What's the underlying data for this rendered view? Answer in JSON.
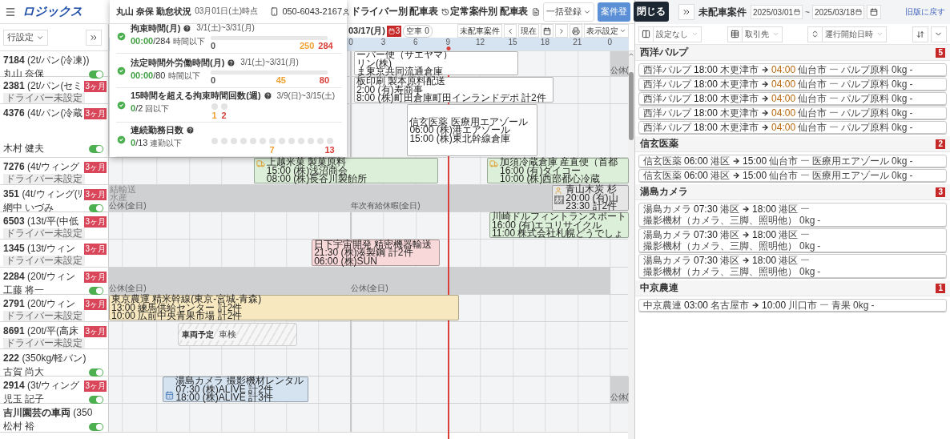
{
  "header": {
    "logo": "ロジックス",
    "nav_tabs": [
      {
        "label": "ドライバー別 配車表",
        "kind": "driver"
      },
      {
        "label": "定常案件別 配車表",
        "kind": "regular"
      }
    ],
    "bulk_button": "一括登録",
    "create_button": "案件登",
    "tooltip": "閉じる"
  },
  "toolbar": {
    "row_settings": "行設定",
    "date": "03/17(月)",
    "alert_count": "3",
    "vacant": "空車 0",
    "unassigned_button": "未配車案件",
    "now_button": "現在",
    "display_settings": "表示設定"
  },
  "axis": [
    "0",
    "3",
    "6",
    "9",
    "12",
    "15",
    "18",
    "21",
    "0"
  ],
  "vehicles": [
    {
      "number": "7184",
      "type": "(2t/パン(冷凍))",
      "driver": "丸山 奈保",
      "driver_set": true,
      "available": true,
      "events": [
        {
          "kind": "plain",
          "color": "#ffffff",
          "lines": [
            "ーパー便（サエヤマ）",
            "リン(株)",
            "ま東京共同流通倉庫"
          ]
        },
        {
          "kind": "holiday",
          "label": "公休("
        }
      ]
    },
    {
      "number": "2381",
      "type": "(2t/パン(セミ",
      "badge": "3ヶ月",
      "driver": "ドライバー未設定",
      "driver_set": false,
      "events": [
        {
          "kind": "plain",
          "color": "#ffffff",
          "lines": [
            "板印刷 製本原料配送",
            "2:00 (有)寿商事",
            "8:00 (株)町田倉庫町田インランドデポ 計2件"
          ]
        }
      ]
    },
    {
      "number": "4376",
      "type": "(4t/パン(冷蔵",
      "badge": "3ヶ月",
      "driver": "木村 健夫",
      "driver_set": true,
      "available": true,
      "events": [
        {
          "kind": "plain",
          "color": "#ffffff",
          "lines": [
            "信玄医薬 医療用エアゾール",
            "06:00 (株)港エアゾール",
            "15:00 (株)東北幹線倉庫"
          ]
        }
      ]
    },
    {
      "number": "7276",
      "type": "(4t/ウィング",
      "badge": "3ヶ月",
      "driver": "ドライバー未設定",
      "driver_set": false,
      "events": [
        {
          "kind": "truck",
          "color": "#dcefd8",
          "lines": [
            "上越米菓 製菓原料",
            "15:00 (株)浅沼商会",
            "08:00 (株)長谷川製飴所"
          ]
        },
        {
          "kind": "truck",
          "color": "#dcefd8",
          "lines": [
            "加須冷蔵倉庫 産直便（首都",
            "16:00 (有)ダイコー",
            "10:00 (株)西部都心冷蔵"
          ]
        }
      ]
    },
    {
      "number": "351",
      "type": "(4t/ウィング(ﾘ",
      "badge": "3ヶ月",
      "driver": "網中 いづみ",
      "driver_set": true,
      "available": true,
      "events": [
        {
          "kind": "ghost",
          "lines": [
            "結輸送",
            "水産"
          ]
        },
        {
          "kind": "holiday",
          "label": "公休(全日)"
        },
        {
          "kind": "holiday",
          "label": "年次有給休暇(全日)"
        },
        {
          "kind": "staff",
          "color": "#e6e6e6",
          "tag": "材",
          "lines": [
            "青山木炭 杉",
            "20:00 (有)山",
            "23:30 計2件"
          ]
        }
      ]
    },
    {
      "number": "6503",
      "type": "(13t/平(中低",
      "badge": "3ヶ月",
      "driver": "ドライバー未設定",
      "driver_set": false,
      "events": [
        {
          "kind": "plain",
          "color": "#dcefd8",
          "lines": [
            "川崎ドルフィントランスポート",
            "16:00 (有)エコリサイクル",
            "11:00 株式会社札幌どうでしょ"
          ]
        }
      ]
    },
    {
      "number": "1345",
      "type": "(13t/ウィン",
      "badge": "3ヶ月",
      "driver": "ドライバー未設定",
      "driver_set": false,
      "events": [
        {
          "kind": "plain",
          "color": "#f8d8d8",
          "lines": [
            "日下宇宙開発 精密機器輸送",
            "21:30 (株)湊製鋼 計2件",
            "06:00 (株)SUN"
          ]
        }
      ]
    },
    {
      "number": "2284",
      "type": "(20t/ウィン",
      "badge": "3ヶ月",
      "driver": "工藤 将一",
      "driver_set": true,
      "available": true,
      "events": [
        {
          "kind": "holiday",
          "label": "公休(全日)"
        },
        {
          "kind": "holiday",
          "label": "公休(全日)"
        }
      ]
    },
    {
      "number": "2791",
      "type": "(20t/ウィン",
      "badge": "3ヶ月",
      "driver": "ドライバー未設定",
      "driver_set": false,
      "events": [
        {
          "kind": "plain",
          "color": "#f7e8c0",
          "lines": [
            "東京農運 精米幹線(東京-宮城-青森)",
            "13:00 練馬供給センター 計2件",
            "10:00 広前中央青果市場 計2件"
          ]
        }
      ]
    },
    {
      "number": "8691",
      "type": "(20t/平(高床",
      "badge": "3ヶ月",
      "driver": "ドライバー未設定",
      "driver_set": false,
      "events": [
        {
          "kind": "maintenance",
          "tag": "車両予定",
          "lines": [
            "車検"
          ]
        }
      ]
    },
    {
      "number": "222",
      "type": "(350kg/軽バン)",
      "driver": "古賀 尚大",
      "driver_set": true,
      "available": true
    },
    {
      "number": "2914",
      "type": "(3t/ウィング",
      "badge": "3ヶ月",
      "driver": "児玉 記子",
      "driver_set": true,
      "available": true,
      "events": [
        {
          "kind": "calendar",
          "color": "#d5e3f1",
          "lines": [
            "湯島カメラ 撮影機材レンタル",
            "07:30 (株)ALIVE 計2件",
            "18:00 (株)ALIVE 計3件"
          ]
        },
        {
          "kind": "holiday",
          "label": "公休("
        }
      ]
    },
    {
      "number": "吉川園芸の車両",
      "type": "(350",
      "driver": "松村 裕",
      "driver_set": true,
      "available": true
    }
  ],
  "attendance": {
    "title": "丸山 奈保 勤怠状況",
    "as_of": "03月01日(土)時点",
    "phone": "050-6043-2167",
    "metrics": [
      {
        "kind": "bar",
        "ok": true,
        "title": "拘束時間(月)",
        "period": "3/1(土)~3/31(月)",
        "value": "00:00",
        "limit": "/284",
        "unit": "時間以下",
        "level": 0,
        "ticks": [
          {
            "label": "0",
            "color": "#555555"
          },
          {
            "label": "250",
            "color": "#f0a030"
          },
          {
            "label": "284",
            "color": "#d9403a"
          }
        ]
      },
      {
        "kind": "bar",
        "ok": true,
        "title": "法定時間外労働時間(月)",
        "period": "3/1(土)~3/31(月)",
        "value": "00:00",
        "limit": "/80",
        "unit": "時間以下",
        "level": 0,
        "ticks": [
          {
            "label": "0",
            "color": "#555555"
          },
          {
            "label": "45",
            "color": "#f0a030"
          },
          {
            "label": "80",
            "color": "#d9403a"
          }
        ]
      },
      {
        "kind": "dots",
        "ok": true,
        "title": "15時間を超える拘束時間回数(週)",
        "period": "3/9(日)~3/15(土)",
        "value": "0",
        "limit": "/2",
        "unit": "回以下",
        "dots": [
          {
            "filled": false,
            "label": "1",
            "color": "#f0a030"
          },
          {
            "filled": false,
            "label": "2",
            "color": "#d9403a"
          }
        ]
      },
      {
        "kind": "dots",
        "ok": true,
        "title": "連続勤務日数",
        "value": "0",
        "limit": "/13",
        "unit": "連勤以下",
        "dots": [
          {
            "filled": false
          },
          {
            "filled": false
          },
          {
            "filled": false
          },
          {
            "filled": false
          },
          {
            "filled": false
          },
          {
            "filled": false
          },
          {
            "filled": false,
            "label": "7",
            "color": "#f0a030"
          },
          {
            "filled": false
          },
          {
            "filled": false
          },
          {
            "filled": false
          },
          {
            "filled": false
          },
          {
            "filled": false
          },
          {
            "filled": false,
            "label": "13",
            "color": "#d9403a"
          }
        ]
      }
    ]
  },
  "unassigned": {
    "title": "未配車案件",
    "date_from": "2025/03/01",
    "date_sep": "~",
    "date_to": "2025/03/18",
    "revert_link": "旧版に戻す",
    "filters": [
      {
        "kind": "columns",
        "value": "設定なし"
      },
      {
        "kind": "table",
        "value": "取引先"
      },
      {
        "kind": "sort",
        "value": "運行開始日時"
      }
    ],
    "groups": [
      {
        "name": "西洋パルプ",
        "count": "5",
        "rows": [
          {
            "company": "西洋パルプ",
            "start": "18:00",
            "origin": "木更津市",
            "end": "04:00",
            "overnight": true,
            "destination": "仙台市",
            "dash": "ー",
            "cargo": "パルプ原料",
            "weight": "0kg",
            "note": "-"
          },
          {
            "company": "西洋パルプ",
            "start": "18:00",
            "origin": "木更津市",
            "end": "04:00",
            "overnight": true,
            "destination": "仙台市",
            "dash": "ー",
            "cargo": "パルプ原料",
            "weight": "0kg",
            "note": "-"
          },
          {
            "company": "西洋パルプ",
            "start": "18:00",
            "origin": "木更津市",
            "end": "04:00",
            "overnight": true,
            "destination": "仙台市",
            "dash": "ー",
            "cargo": "パルプ原料",
            "weight": "0kg",
            "note": "-"
          },
          {
            "company": "西洋パルプ",
            "start": "18:00",
            "origin": "木更津市",
            "end": "04:00",
            "overnight": true,
            "destination": "仙台市",
            "dash": "ー",
            "cargo": "パルプ原料",
            "weight": "0kg",
            "note": "-"
          },
          {
            "company": "西洋パルプ",
            "start": "18:00",
            "origin": "木更津市",
            "end": "04:00",
            "overnight": true,
            "destination": "仙台市",
            "dash": "ー",
            "cargo": "パルプ原料",
            "weight": "0kg",
            "note": "-"
          }
        ]
      },
      {
        "name": "信玄医薬",
        "count": "2",
        "rows": [
          {
            "company": "信玄医薬",
            "start": "06:00",
            "origin": "港区",
            "end": "15:00",
            "overnight": false,
            "destination": "仙台市",
            "dash": "ー",
            "cargo": "医療用エアゾール",
            "weight": "0kg",
            "note": "-"
          },
          {
            "company": "信玄医薬",
            "start": "06:00",
            "origin": "港区",
            "end": "15:00",
            "overnight": false,
            "destination": "仙台市",
            "dash": "ー",
            "cargo": "医療用エアゾール",
            "weight": "0kg",
            "note": "-"
          }
        ]
      },
      {
        "name": "湯島カメラ",
        "count": "3",
        "rows": [
          {
            "company": "湯島カメラ",
            "start": "07:30",
            "origin": "港区",
            "end": "18:00",
            "overnight": false,
            "destination": "港区",
            "dash": "ー",
            "cargo": "撮影機材（カメラ、三脚、照明他）",
            "weight": "0kg",
            "note": "-"
          },
          {
            "company": "湯島カメラ",
            "start": "07:30",
            "origin": "港区",
            "end": "18:00",
            "overnight": false,
            "destination": "港区",
            "dash": "ー",
            "cargo": "撮影機材（カメラ、三脚、照明他）",
            "weight": "0kg",
            "note": "-"
          },
          {
            "company": "湯島カメラ",
            "start": "07:30",
            "origin": "港区",
            "end": "18:00",
            "overnight": false,
            "destination": "港区",
            "dash": "ー",
            "cargo": "撮影機材（カメラ、三脚、照明他）",
            "weight": "0kg",
            "note": "-"
          }
        ]
      },
      {
        "name": "中京農連",
        "count": "1",
        "rows": [
          {
            "company": "中京農連",
            "start": "03:00",
            "origin": "名古屋市",
            "end": "10:00",
            "overnight": false,
            "destination": "川口市",
            "dash": "ー",
            "cargo": "青果",
            "weight": "0kg",
            "note": "-"
          }
        ]
      }
    ]
  }
}
